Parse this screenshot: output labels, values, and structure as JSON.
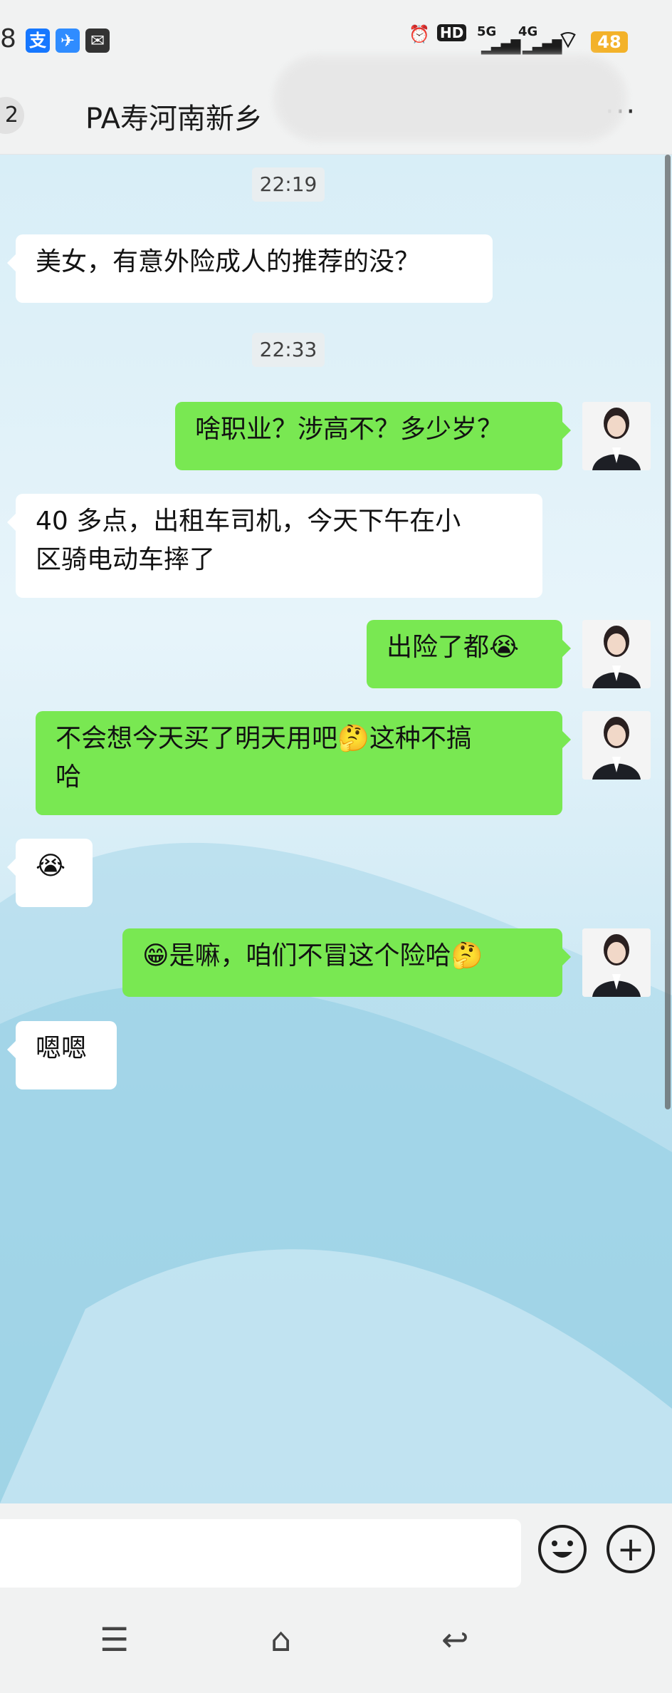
{
  "status": {
    "time": "8",
    "icons": [
      "alipay-icon",
      "bird-icon",
      "message-icon"
    ],
    "network": {
      "hd": "HD",
      "sim1": "5G",
      "sim2": "4G"
    },
    "battery": "48"
  },
  "header": {
    "unread": "2",
    "title": "PA寿河南新乡",
    "more": "···"
  },
  "messages": [
    {
      "type": "timestamp",
      "text": "22:19"
    },
    {
      "type": "in",
      "text": "美女，有意外险成人的推荐的没？"
    },
    {
      "type": "timestamp",
      "text": "22:33"
    },
    {
      "type": "out",
      "text": "啥职业？涉高不？多少岁？"
    },
    {
      "type": "in",
      "line1": "40 多点，出租车司机，今天下午在小",
      "line2": "区骑电动车摔了"
    },
    {
      "type": "out",
      "text": "出险了都",
      "emoji": "😭"
    },
    {
      "type": "out",
      "line1a": "不会想今天买了明天用吧",
      "emoji": "🤔",
      "line1b": "这种不搞",
      "line2": "哈"
    },
    {
      "type": "in",
      "emoji": "😭"
    },
    {
      "type": "out",
      "emoji1": "😁",
      "text": "是嘛，咱们不冒这个险哈",
      "emoji2": "🤔"
    },
    {
      "type": "in",
      "text": "嗯嗯"
    }
  ],
  "input": {
    "value": "",
    "emoji_button": "emoji-face-icon",
    "plus_button": "+"
  },
  "nav": {
    "menu": "☰",
    "home": "⌂",
    "back": "↩"
  },
  "colors": {
    "out_bubble": "#79e852",
    "in_bubble": "#ffffff",
    "battery": "#f3b22a"
  }
}
